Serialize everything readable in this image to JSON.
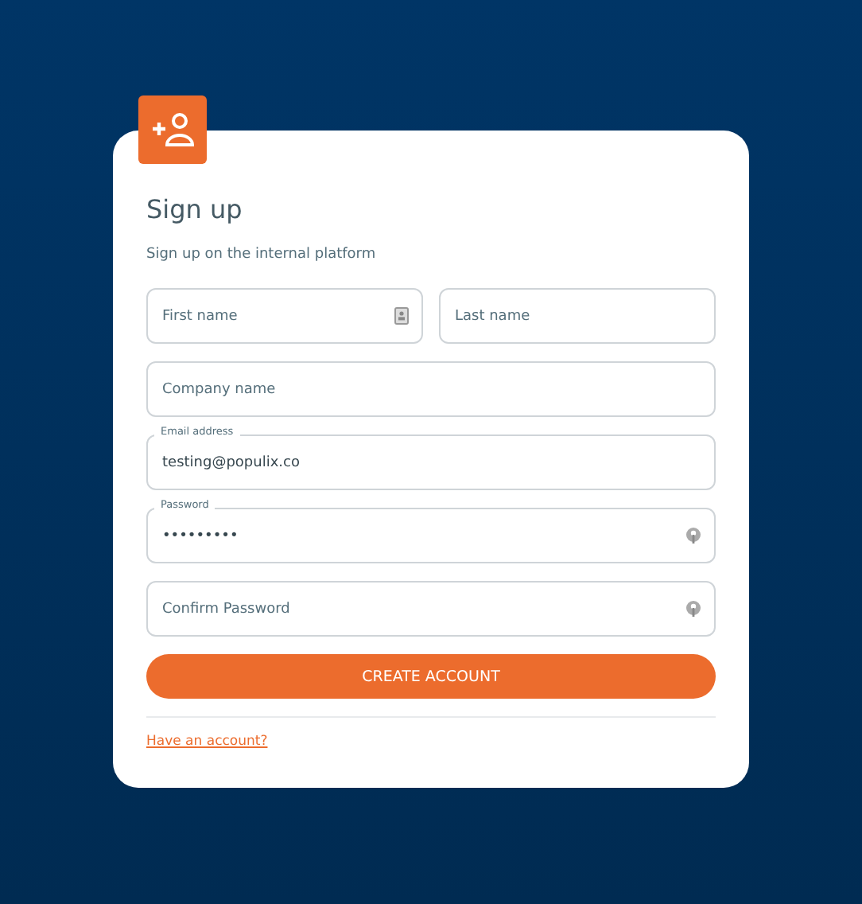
{
  "card": {
    "title": "Sign up",
    "subtitle": "Sign up on the internal platform"
  },
  "rows": [
    {
      "fields": [
        {
          "kind": "name",
          "placeholder": "First name"
        },
        {
          "kind": "plain",
          "placeholder": "Last name"
        }
      ]
    },
    {
      "fields": [
        {
          "kind": "plain",
          "placeholder": "Company name"
        }
      ]
    },
    {
      "fields": [
        {
          "kind": "plain",
          "label": "Email address",
          "value": "testing@populix.co"
        }
      ]
    },
    {
      "fields": [
        {
          "kind": "password",
          "label": "Password",
          "value": "•••••••••"
        }
      ]
    },
    {
      "fields": [
        {
          "kind": "password",
          "placeholder": "Confirm Password"
        }
      ]
    }
  ],
  "submit": "CREATE ACCOUNT",
  "link": "Have an account?"
}
